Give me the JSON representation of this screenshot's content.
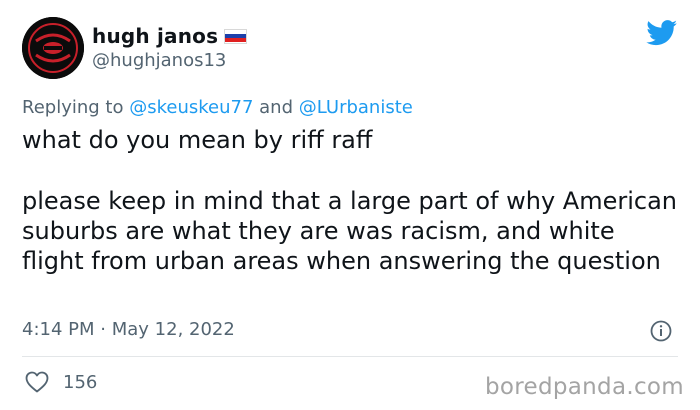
{
  "author": {
    "display_name": "hugh janos",
    "handle": "@hughjanos13",
    "flag_colors": [
      "#ffffff",
      "#1c3faa",
      "#e02020"
    ]
  },
  "brand_icon": "twitter-bird-icon",
  "brand_color": "#1d9bf0",
  "reply": {
    "prefix": "Replying to",
    "mention_1": "@skeuskeu77",
    "conjunction": "and",
    "mention_2": "@LUrbaniste"
  },
  "tweet": {
    "line_1": "what do you mean by riff raff",
    "line_2": "please keep in mind that a large part of why American suburbs are what they are was racism, and white flight from urban areas when answering the question"
  },
  "meta": {
    "time": "4:14 PM",
    "separator": "·",
    "date": "May 12, 2022"
  },
  "engagement": {
    "likes": "156"
  },
  "watermark": "boredpanda.com"
}
